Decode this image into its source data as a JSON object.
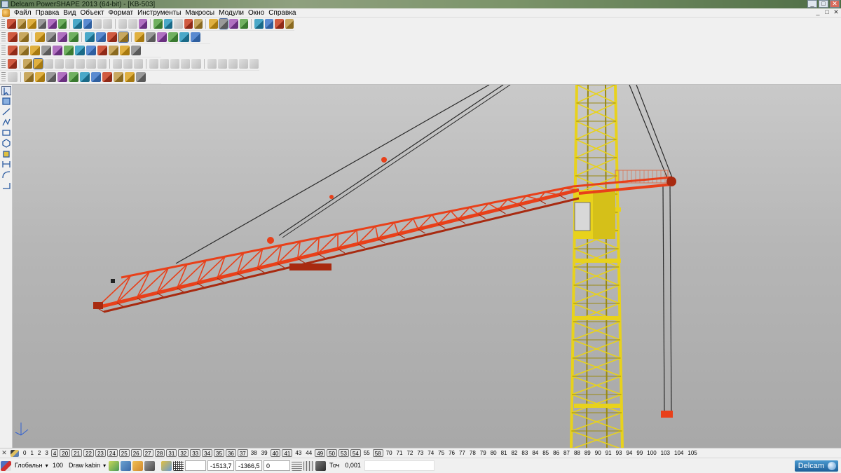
{
  "window": {
    "title": "Delcam PowerSHAPE 2013 (64-bit) - [KB-503]",
    "buttons": [
      "_",
      "□",
      "✕"
    ]
  },
  "menubar": {
    "items": [
      "Файл",
      "Правка",
      "Вид",
      "Объект",
      "Формат",
      "Инструменты",
      "Макросы",
      "Модули",
      "Окно",
      "Справка"
    ],
    "mdi_buttons": [
      "_",
      "□",
      "✕"
    ]
  },
  "viewport": {
    "background": "#b8b8b8",
    "colors": {
      "boom": "#e8401a",
      "boom_dark": "#a82a10",
      "tower": "#e8d21c",
      "tower_dark": "#9a8a10",
      "cable": "#2a2a2a"
    }
  },
  "levels": {
    "items": [
      {
        "label": "0"
      },
      {
        "label": "1"
      },
      {
        "label": "2"
      },
      {
        "label": "3"
      },
      {
        "label": "4",
        "boxed": true
      },
      {
        "label": "20",
        "boxed": true
      },
      {
        "label": "21",
        "boxed": true
      },
      {
        "label": "22",
        "boxed": true
      },
      {
        "label": "23",
        "boxed": true
      },
      {
        "label": "24",
        "boxed": true
      },
      {
        "label": "25",
        "boxed": true
      },
      {
        "label": "26",
        "boxed": true
      },
      {
        "label": "27",
        "boxed": true
      },
      {
        "label": "28",
        "boxed": true
      },
      {
        "label": "31",
        "boxed": true
      },
      {
        "label": "32",
        "boxed": true
      },
      {
        "label": "33",
        "boxed": true
      },
      {
        "label": "34",
        "boxed": true
      },
      {
        "label": "35",
        "boxed": true
      },
      {
        "label": "36",
        "boxed": true
      },
      {
        "label": "37",
        "boxed": true
      },
      {
        "label": "38"
      },
      {
        "label": "39"
      },
      {
        "label": "40",
        "boxed": true
      },
      {
        "label": "41",
        "boxed": true
      },
      {
        "label": "43"
      },
      {
        "label": "44"
      },
      {
        "label": "49",
        "boxed": true
      },
      {
        "label": "50",
        "boxed": true
      },
      {
        "label": "53",
        "boxed": true
      },
      {
        "label": "54",
        "boxed": true
      },
      {
        "label": "55"
      },
      {
        "label": "58",
        "boxed": true
      },
      {
        "label": "70"
      },
      {
        "label": "71"
      },
      {
        "label": "72"
      },
      {
        "label": "73"
      },
      {
        "label": "74"
      },
      {
        "label": "75"
      },
      {
        "label": "76"
      },
      {
        "label": "77"
      },
      {
        "label": "78"
      },
      {
        "label": "79"
      },
      {
        "label": "80"
      },
      {
        "label": "81"
      },
      {
        "label": "82"
      },
      {
        "label": "83"
      },
      {
        "label": "84"
      },
      {
        "label": "85"
      },
      {
        "label": "86"
      },
      {
        "label": "87"
      },
      {
        "label": "88"
      },
      {
        "label": "89"
      },
      {
        "label": "90"
      },
      {
        "label": "91"
      },
      {
        "label": "93"
      },
      {
        "label": "94"
      },
      {
        "label": "99"
      },
      {
        "label": "100"
      },
      {
        "label": "103"
      },
      {
        "label": "104"
      },
      {
        "label": "105"
      }
    ]
  },
  "status": {
    "workplane": "Глобальн",
    "level_number": "100",
    "level_name": "Draw kabin",
    "coord_x": "-1513,7",
    "coord_y": "-1366,5",
    "coord_z": "0",
    "tolerance_label": "Точ",
    "tolerance_value": "0,001",
    "logo_text": "Delcam"
  }
}
